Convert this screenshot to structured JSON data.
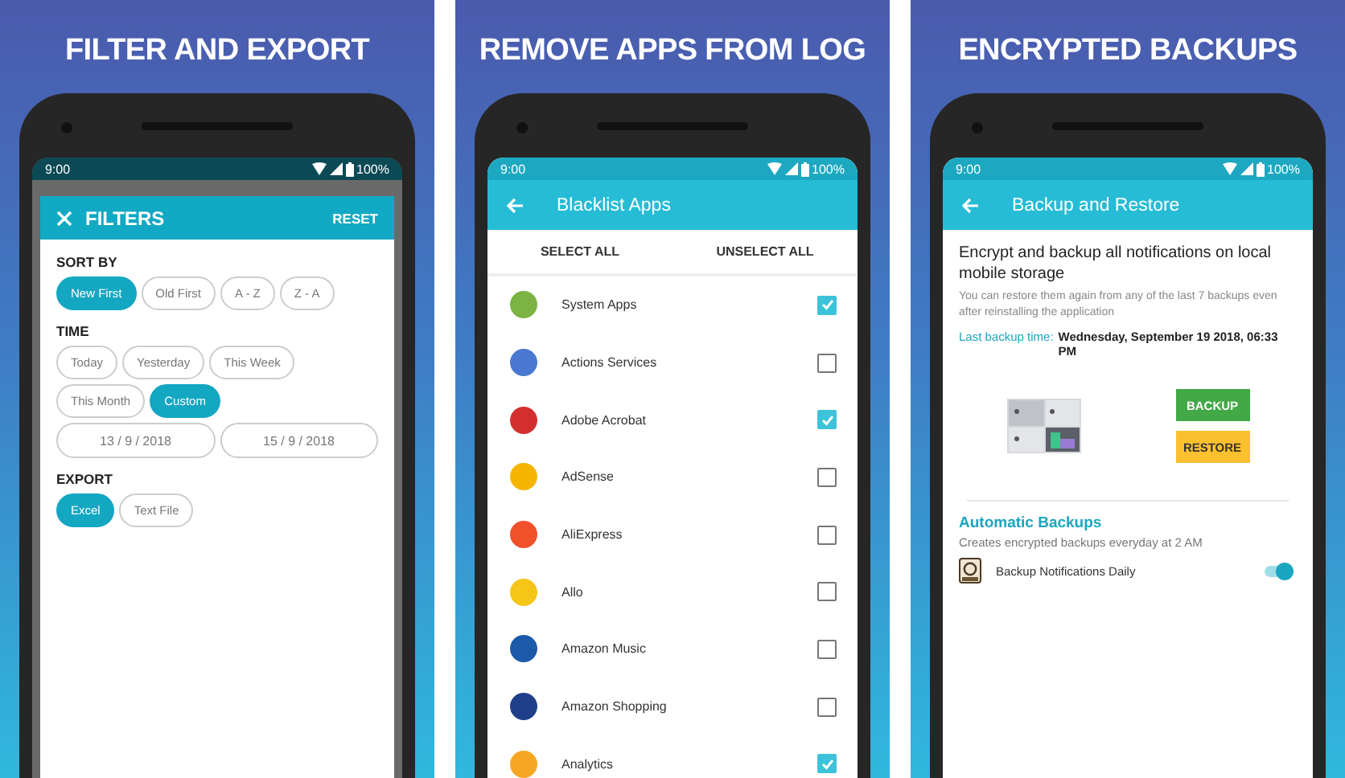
{
  "panels": [
    {
      "headline": "FILTER AND EXPORT",
      "kind": "filters",
      "scrim": true,
      "status": {
        "time": "9:00",
        "battery": "100%"
      },
      "dialog": {
        "title": "FILTERS",
        "action": "RESET",
        "sections": [
          {
            "heading": "SORT BY",
            "chips": [
              {
                "label": "New First",
                "selected": true
              },
              {
                "label": "Old First",
                "selected": false
              },
              {
                "label": "A - Z",
                "selected": false
              },
              {
                "label": "Z - A",
                "selected": false
              }
            ]
          },
          {
            "heading": "TIME",
            "chips": [
              {
                "label": "Today",
                "selected": false
              },
              {
                "label": "Yesterday",
                "selected": false
              },
              {
                "label": "This Week",
                "selected": false
              },
              {
                "label": "This Month",
                "selected": false
              },
              {
                "label": "Custom",
                "selected": true
              }
            ],
            "dates": [
              "13 / 9 / 2018",
              "15 / 9 / 2018"
            ]
          },
          {
            "heading": "EXPORT",
            "chips": [
              {
                "label": "Excel",
                "selected": true
              },
              {
                "label": "Text File",
                "selected": false
              }
            ]
          }
        ]
      }
    },
    {
      "headline": "REMOVE APPS FROM LOG",
      "kind": "apps",
      "scrim": false,
      "status": {
        "time": "9:00",
        "battery": "100%"
      },
      "toolbar": {
        "title": "Blacklist Apps"
      },
      "actions": [
        "SELECT ALL",
        "UNSELECT ALL"
      ],
      "apps": [
        {
          "name": "System Apps",
          "checked": true,
          "color": "#7cb342"
        },
        {
          "name": "Actions Services",
          "checked": false,
          "color": "#4a78d0"
        },
        {
          "name": "Adobe Acrobat",
          "checked": true,
          "color": "#d32f2f"
        },
        {
          "name": "AdSense",
          "checked": false,
          "color": "#f4b400"
        },
        {
          "name": "AliExpress",
          "checked": false,
          "color": "#f0502a"
        },
        {
          "name": "Allo",
          "checked": false,
          "color": "#f5c518"
        },
        {
          "name": "Amazon Music",
          "checked": false,
          "color": "#1a5aa8"
        },
        {
          "name": "Amazon Shopping",
          "checked": false,
          "color": "#1f3f8a"
        },
        {
          "name": "Analytics",
          "checked": true,
          "color": "#f5a623"
        }
      ]
    },
    {
      "headline": "ENCRYPTED BACKUPS",
      "kind": "backup",
      "scrim": false,
      "status": {
        "time": "9:00",
        "battery": "100%"
      },
      "toolbar": {
        "title": "Backup and Restore"
      },
      "intro": "Encrypt and backup all notifications on local mobile storage",
      "note": "You can restore them again from any of the last 7 backups even after reinstalling the application",
      "last_backup": {
        "label": "Last backup time:",
        "value": "Wednesday, September 19 2018, 06:33 PM"
      },
      "buttons": [
        {
          "label": "BACKUP",
          "kind": "primary"
        },
        {
          "label": "RESTORE",
          "kind": "warning"
        }
      ],
      "automatic": {
        "heading": "Automatic Backups",
        "subtitle": "Creates encrypted backups everyday at 2 AM",
        "setting": {
          "label": "Backup Notifications Daily",
          "on": true
        }
      }
    }
  ]
}
